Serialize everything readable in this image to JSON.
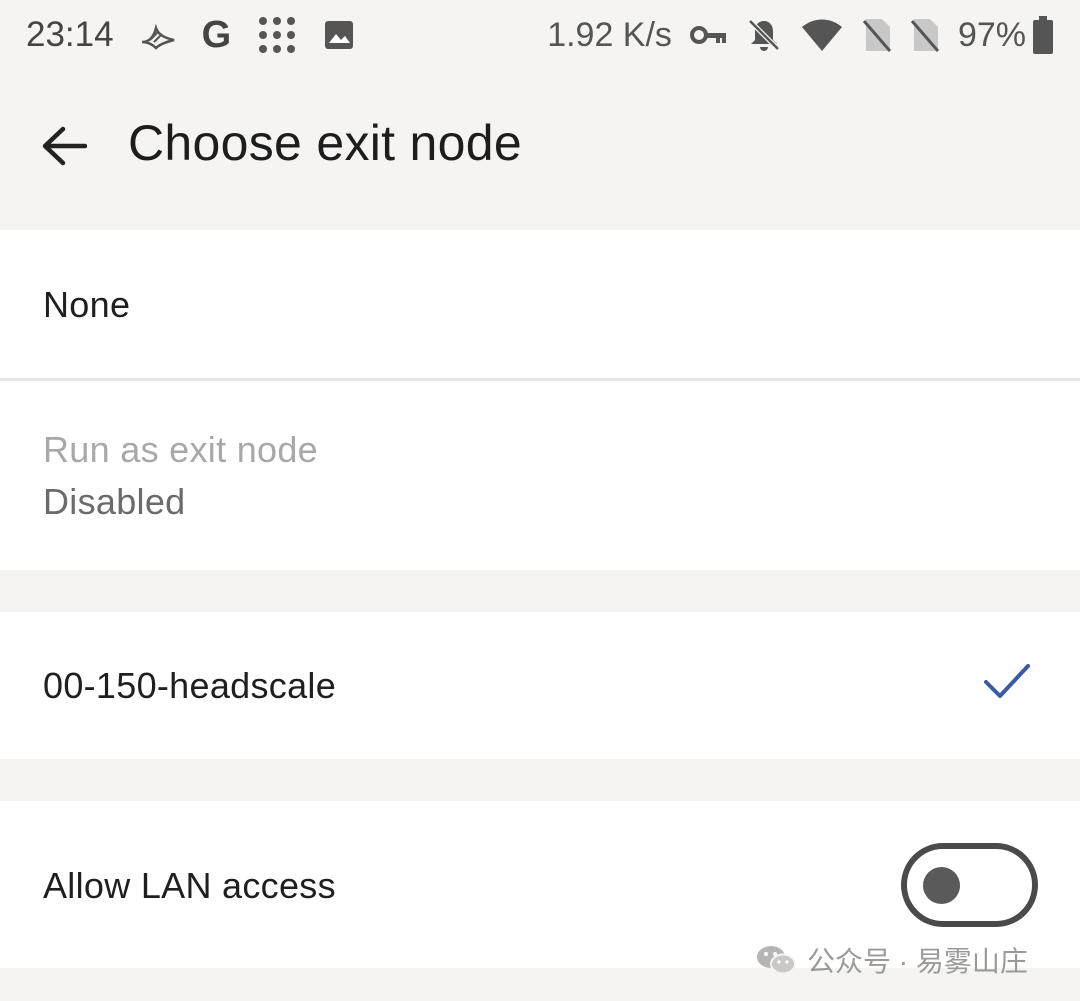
{
  "status_bar": {
    "time": "23:14",
    "google_letter": "G",
    "net_speed": "1.92 K/s",
    "battery": "97%",
    "icons": [
      "bird-icon",
      "google-icon",
      "grid-dots-icon",
      "image-icon",
      "vpn-key-icon",
      "bell-off-icon",
      "wifi-icon",
      "no-sim-icon",
      "no-sim-icon",
      "battery-icon"
    ]
  },
  "app_bar": {
    "title": "Choose exit node",
    "back_icon": "arrow-left-icon"
  },
  "options": {
    "none_label": "None",
    "run_title": "Run as exit node",
    "run_status": "Disabled",
    "node_label": "00-150-headscale",
    "node_selected": true,
    "lan_label": "Allow LAN access",
    "lan_enabled": false
  },
  "watermark": {
    "text": "公众号 · 易雾山庄"
  },
  "colors": {
    "accent": "#3b5aa6",
    "background": "#f5f4f2"
  }
}
